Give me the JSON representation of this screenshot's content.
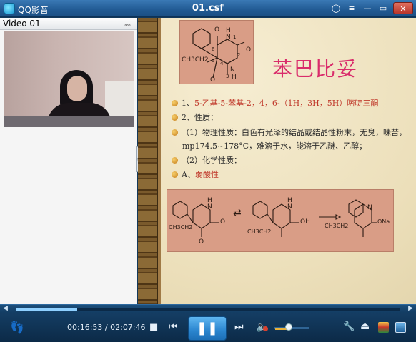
{
  "window": {
    "app_name": "QQ影音",
    "file_name": "01.csf"
  },
  "title_buttons": [
    {
      "name": "mini-mode-icon",
      "glyph": "◯"
    },
    {
      "name": "settings-icon",
      "glyph": "≡"
    },
    {
      "name": "minimize-icon",
      "glyph": "—"
    },
    {
      "name": "maximize-icon",
      "glyph": "▭"
    },
    {
      "name": "close-icon",
      "glyph": "✕"
    }
  ],
  "video_panel": {
    "title": "Video 01",
    "collapse_glyph": "︽",
    "splitter_glyph": "‹"
  },
  "slide": {
    "drug_title": "苯巴比妥",
    "structure1": {
      "labels": [
        "O",
        "H",
        "N",
        "1",
        "6",
        "2",
        "O",
        "5",
        "4",
        "3",
        "N",
        "H",
        "O",
        "CH3CH2"
      ]
    },
    "items": [
      {
        "prefix": "1、",
        "text": "5-乙基-5-苯基-2，4，6-（1H，3H，5H）嘧啶三酮",
        "highlight": true
      },
      {
        "prefix": "2、",
        "text": "性质：",
        "highlight": false
      },
      {
        "prefix": "",
        "text": "（1）物理性质：白色有光泽的结晶或结晶性粉末，无臭，味苦，",
        "highlight": false
      },
      {
        "prefix": "",
        "text": "mp174.5~178°C，难溶于水，能溶于乙醚、乙醇；",
        "highlight": false,
        "no_bullet": true
      },
      {
        "prefix": "",
        "text": "（2）化学性质：",
        "highlight": false
      },
      {
        "prefix": "A、",
        "text": "弱酸性",
        "highlight": true
      }
    ],
    "structure2": {
      "labels": [
        "H",
        "N",
        "O",
        "O",
        "H",
        "N",
        "OH",
        "N",
        "ONa",
        "CH3CH2",
        "CH3CH2",
        "CH3CH2"
      ],
      "arrow_glyph": "⇄"
    }
  },
  "seekbar": {
    "left_glyph": "◀",
    "right_glyph": "▶",
    "progress": 0.16
  },
  "controls": {
    "time_current": "00:16:53",
    "time_total": "02:07:46",
    "time_separator": " / ",
    "stop_glyph": "■",
    "prev_glyph": "⏮",
    "play_glyph": "❚❚",
    "next_glyph": "⏭",
    "volume_glyph": "🔈",
    "volume_level": 0.4,
    "footprint_glyph": "👣",
    "tool_glyph": "🔧",
    "eject_glyph": "⏏",
    "colors": {
      "accent": "#2a85cf",
      "volume": "#e8b13a",
      "mute_badge": "#d9412f"
    }
  }
}
